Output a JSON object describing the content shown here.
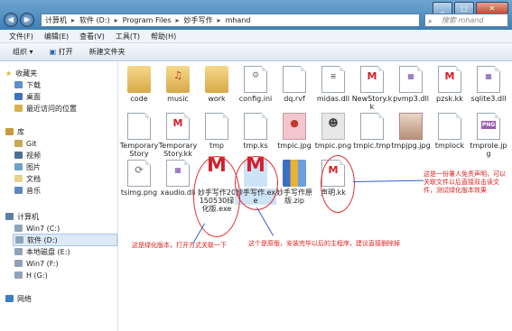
{
  "address": {
    "crumbs": [
      "计算机",
      "软件 (D:)",
      "Program Files",
      "妙手写作",
      "mhand"
    ]
  },
  "search": {
    "placeholder": "搜索 mhand"
  },
  "menu": [
    "文件(F)",
    "编辑(E)",
    "查看(V)",
    "工具(T)",
    "帮助(H)"
  ],
  "toolbar": {
    "organize": "组织 ▾",
    "open": "打开",
    "new_folder": "新建文件夹"
  },
  "sidebar": {
    "favorites": "收藏夹",
    "downloads": "下载",
    "desktop": "桌面",
    "recent": "最近访问的位置",
    "library": "库",
    "git": "Git",
    "video": "视频",
    "pictures": "图片",
    "documents": "文档",
    "music": "音乐",
    "computer": "计算机",
    "win7c": "Win7 (C:)",
    "softd": "软件 (D:)",
    "locale": "本地磁盘 (E:)",
    "win7f": "Win7 (F:)",
    "hg": "H (G:)",
    "network": "网络"
  },
  "files": {
    "f1": "code",
    "f2": "music",
    "f3": "work",
    "f4": "config.ini",
    "f5": "dq.rvf",
    "f6": "midas.dll",
    "f7": "NewStory.kk",
    "f8": "pvmp3.dll",
    "f9": "pzsk.kk",
    "f10": "sqlite3.dll",
    "f11": "TemporaryStory",
    "f12": "TemporaryStory.kk",
    "f13": "tmp",
    "f14": "tmp.ks",
    "f15": "tmpic.jpg",
    "f16": "tmpic.png",
    "f17": "tmpic.tmp",
    "f18": "tmpjpg.jpg",
    "f19": "tmplock",
    "f20": "tmprole.jpg",
    "f21": "tsimg.png",
    "f22": "xaudio.dll",
    "f23": "妙手写作20150530绿化版.exe",
    "f24": "妙手写作.exe",
    "f25": "妙手写作原版.zip",
    "f26": "声明.kk"
  },
  "notes": {
    "n1": "这是一份署人免责声明，可以关联文件以后直接双击读文件，测试绿化版本效果",
    "n2": "这是绿化版本，打开方式关联一下",
    "n3": "这个是原版，安装完毕以后的主程序，建议直接删除掉"
  },
  "colors": {
    "accent": "#3d7fb6",
    "annotation": "#e02020",
    "arrow": "#3060c8"
  }
}
